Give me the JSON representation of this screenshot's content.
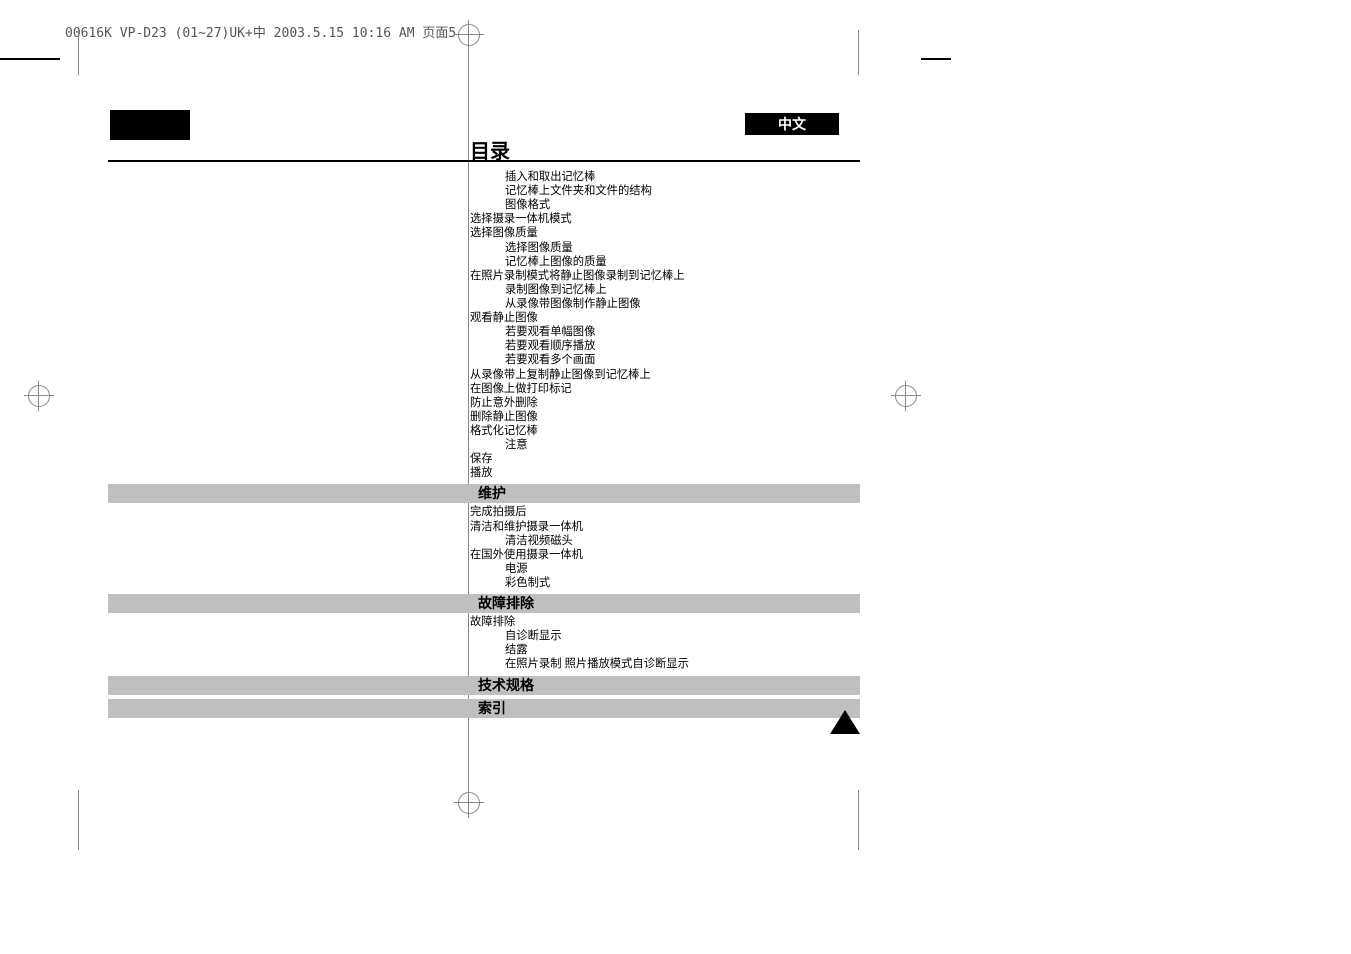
{
  "header": "00616K VP-D23 (01~27)UK+中  2003.5.15 10:16 AM  页面5",
  "lang": "中文",
  "title": "目录",
  "toc_body": [
    {
      "cls": "ind1",
      "txt": "插入和取出记忆棒"
    },
    {
      "cls": "ind1",
      "txt": "记忆棒上文件夹和文件的结构"
    },
    {
      "cls": "ind1",
      "txt": "图像格式"
    },
    {
      "cls": "ind0",
      "txt": "选择摄录一体机模式"
    },
    {
      "cls": "ind0",
      "txt": "选择图像质量"
    },
    {
      "cls": "ind1",
      "txt": "选择图像质量"
    },
    {
      "cls": "ind1",
      "txt": "记忆棒上图像的质量"
    },
    {
      "cls": "ind0",
      "txt": "在照片录制模式将静止图像录制到记忆棒上"
    },
    {
      "cls": "ind1",
      "txt": "录制图像到记忆棒上"
    },
    {
      "cls": "ind1",
      "txt": "从录像带图像制作静止图像"
    },
    {
      "cls": "ind0",
      "txt": "观看静止图像"
    },
    {
      "cls": "ind1",
      "txt": "若要观看单幅图像"
    },
    {
      "cls": "ind1",
      "txt": "若要观看顺序播放"
    },
    {
      "cls": "ind1",
      "txt": "若要观看多个画面"
    },
    {
      "cls": "ind0",
      "txt": "从录像带上复制静止图像到记忆棒上"
    },
    {
      "cls": "ind0",
      "txt": "在图像上做打印标记"
    },
    {
      "cls": "ind0",
      "txt": "防止意外删除"
    },
    {
      "cls": "ind0",
      "txt": "删除静止图像"
    },
    {
      "cls": "ind0",
      "txt": "格式化记忆棒"
    },
    {
      "cls": "ind1",
      "txt": "注意"
    },
    {
      "cls": "ind0",
      "txt": "保存"
    },
    {
      "cls": "ind0",
      "txt": "播放"
    }
  ],
  "sections": [
    {
      "heading": "维护",
      "items": [
        {
          "cls": "ind0",
          "txt": "完成拍摄后"
        },
        {
          "cls": "ind0",
          "txt": "清洁和维护摄录一体机"
        },
        {
          "cls": "ind1",
          "txt": "清洁视频磁头"
        },
        {
          "cls": "ind0",
          "txt": "在国外使用摄录一体机"
        },
        {
          "cls": "ind1",
          "txt": "电源"
        },
        {
          "cls": "ind1",
          "txt": "彩色制式"
        }
      ]
    },
    {
      "heading": "故障排除",
      "items": [
        {
          "cls": "ind0",
          "txt": "故障排除"
        },
        {
          "cls": "ind1",
          "txt": "自诊断显示"
        },
        {
          "cls": "ind1",
          "txt": "结露"
        },
        {
          "cls": "ind1",
          "txt": "在照片录制 照片播放模式自诊断显示"
        }
      ]
    },
    {
      "heading": "技术规格",
      "items": []
    },
    {
      "heading": "索引",
      "items": []
    }
  ]
}
